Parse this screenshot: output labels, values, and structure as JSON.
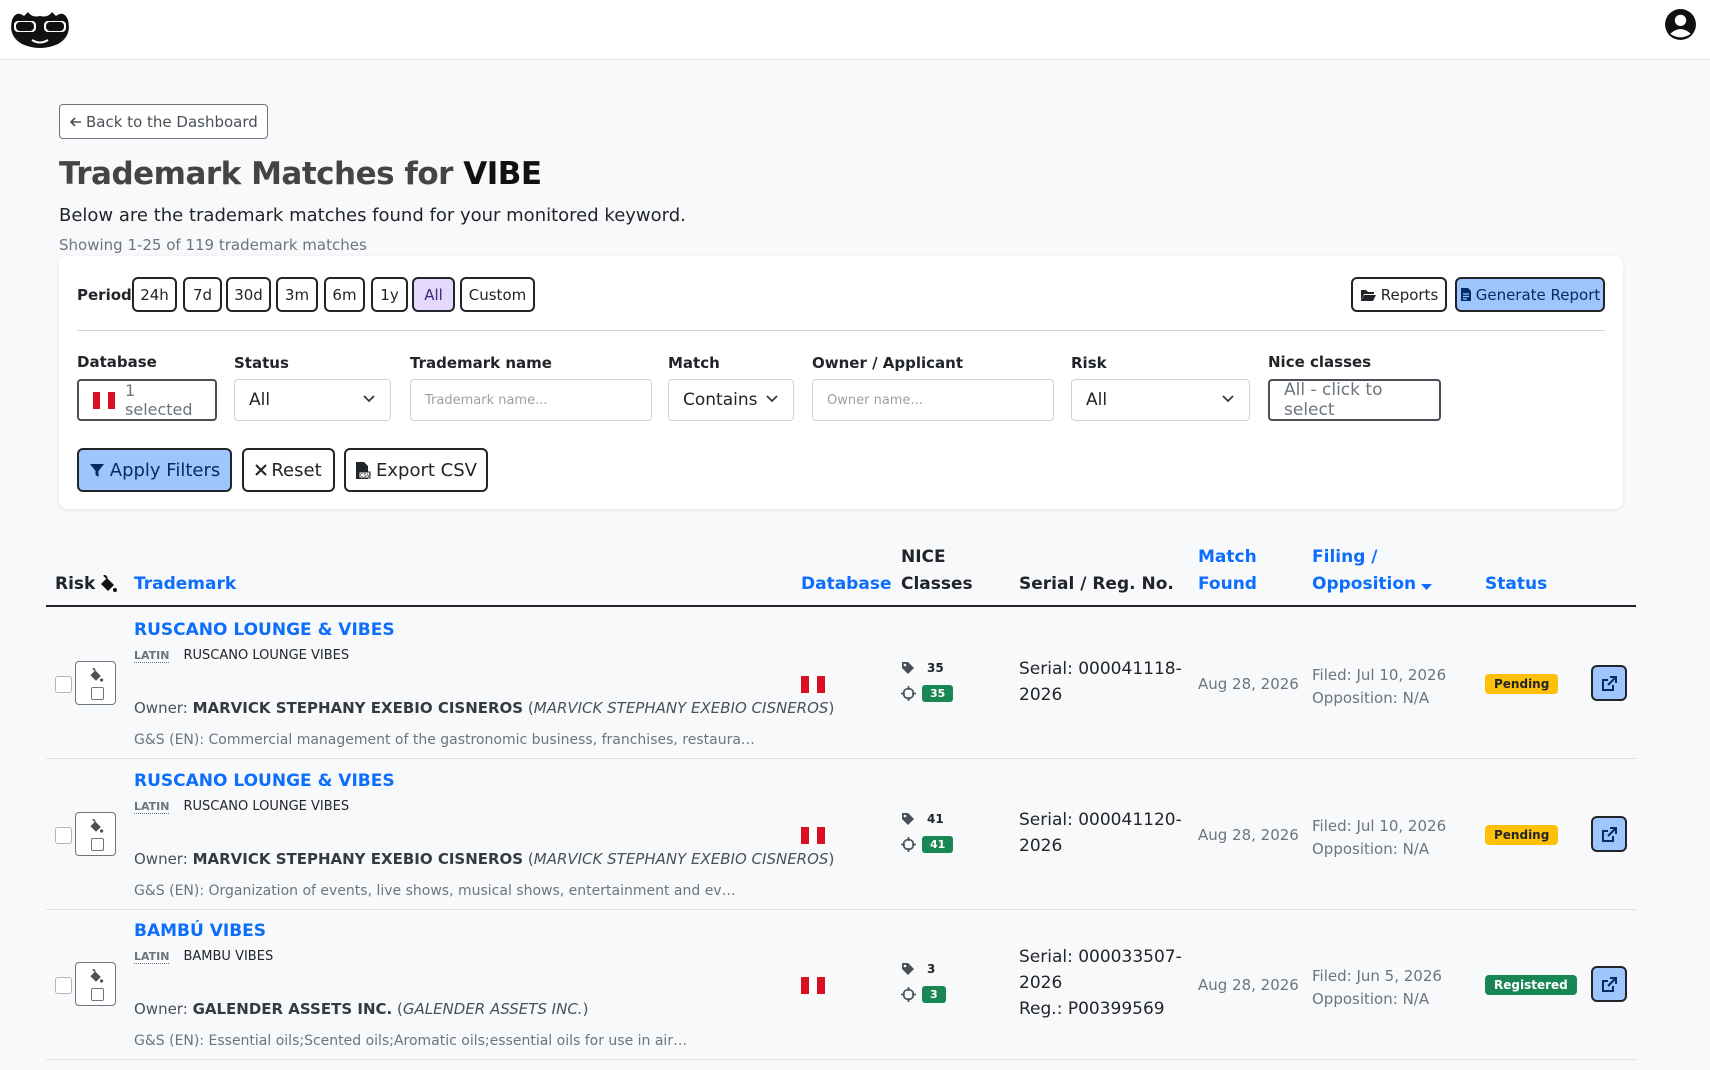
{
  "header": {
    "logo": "sunglasses-logo",
    "user_icon": "user-circle-icon"
  },
  "nav": {
    "back_label": "Back to the Dashboard"
  },
  "page": {
    "title_prefix": "Trademark Matches for",
    "keyword": "VIBE",
    "subtitle": "Below are the trademark matches found for your monitored keyword.",
    "showing": "Showing 1-25 of 119 trademark matches"
  },
  "period": {
    "label": "Period",
    "options": [
      "24h",
      "7d",
      "30d",
      "3m",
      "6m",
      "1y",
      "All",
      "Custom"
    ],
    "selected": "All"
  },
  "actions": {
    "reports": "Reports",
    "generate": "Generate Report"
  },
  "filters": {
    "database": {
      "label": "Database",
      "value": "1 selected"
    },
    "status": {
      "label": "Status",
      "value": "All"
    },
    "trademark": {
      "label": "Trademark name",
      "placeholder": "Trademark name..."
    },
    "match": {
      "label": "Match",
      "value": "Contains"
    },
    "owner": {
      "label": "Owner / Applicant",
      "placeholder": "Owner name..."
    },
    "risk": {
      "label": "Risk",
      "value": "All"
    },
    "nice": {
      "label": "Nice classes",
      "value": "All - click to select"
    }
  },
  "buttons": {
    "apply": "Apply Filters",
    "reset": "Reset",
    "export": "Export CSV"
  },
  "table": {
    "headers": {
      "risk": "Risk",
      "trademark": "Trademark",
      "database": "Database",
      "nice_1": "NICE",
      "nice_2": "Classes",
      "serial": "Serial / Reg. No.",
      "match_1": "Match",
      "match_2": "Found",
      "filing_1": "Filing /",
      "filing_2": "Opposition",
      "status": "Status"
    },
    "rows": [
      {
        "name": "RUSCANO LOUNGE & VIBES",
        "latin_tag": "LATIN",
        "latin": "RUSCANO LOUNGE VIBES",
        "owner_label": "Owner:",
        "owner": "MARVICK STEPHANY EXEBIO CISNEROS",
        "owner_alt": "MARVICK STEPHANY EXEBIO CISNEROS",
        "gs": "G&S (EN): Commercial management of the gastronomic business, franchises, restaura…",
        "class_tag": "35",
        "class_match": "35",
        "serial_1": "Serial: 000041118-",
        "serial_2": "2026",
        "reg": "",
        "match_found": "Aug 28, 2026",
        "filed": "Filed: Jul 10, 2026",
        "opposition": "Opposition: N/A",
        "status": "Pending"
      },
      {
        "name": "RUSCANO LOUNGE & VIBES",
        "latin_tag": "LATIN",
        "latin": "RUSCANO LOUNGE VIBES",
        "owner_label": "Owner:",
        "owner": "MARVICK STEPHANY EXEBIO CISNEROS",
        "owner_alt": "MARVICK STEPHANY EXEBIO CISNEROS",
        "gs": "G&S (EN): Organization of events, live shows, musical shows, entertainment and ev…",
        "class_tag": "41",
        "class_match": "41",
        "serial_1": "Serial: 000041120-",
        "serial_2": "2026",
        "reg": "",
        "match_found": "Aug 28, 2026",
        "filed": "Filed: Jul 10, 2026",
        "opposition": "Opposition: N/A",
        "status": "Pending"
      },
      {
        "name": "BAMBÚ VIBES",
        "latin_tag": "LATIN",
        "latin": "BAMBU VIBES",
        "owner_label": "Owner:",
        "owner": "GALENDER ASSETS INC.",
        "owner_alt": "GALENDER ASSETS INC.",
        "gs": "G&S (EN): Essential oils;Scented oils;Aromatic oils;essential oils for use in air…",
        "class_tag": "3",
        "class_match": "3",
        "serial_1": "Serial: 000033507-",
        "serial_2": "2026",
        "reg": "Reg.: P00399569",
        "match_found": "Aug 28, 2026",
        "filed": "Filed: Jun 5, 2026",
        "opposition": "Opposition: N/A",
        "status": "Registered"
      }
    ]
  },
  "colors": {
    "link": "#0d6efd",
    "primary_btn": "#9ec5fe",
    "active_period": "#e4d8fb",
    "pending": "#ffc107",
    "registered": "#198754",
    "flag_red": "#d91023"
  }
}
